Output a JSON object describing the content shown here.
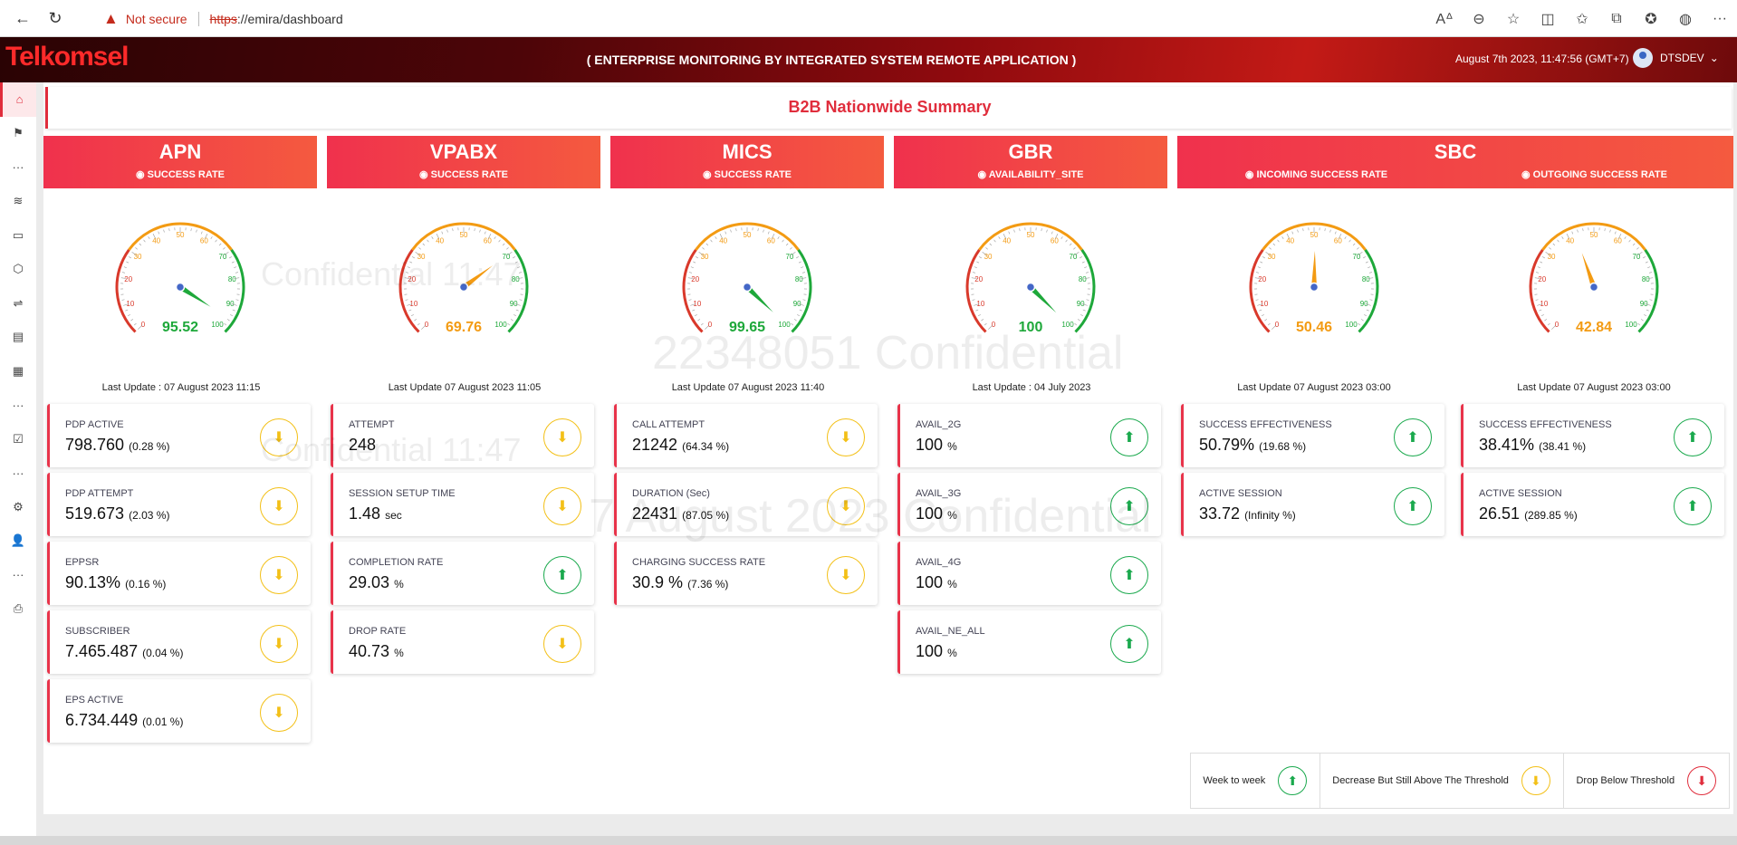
{
  "browser": {
    "not_secure": "Not secure",
    "url_protocol": "https",
    "url_rest": "://emira/dashboard"
  },
  "header": {
    "brand": "Telkomsel",
    "title": "( ENTERPRISE MONITORING BY INTEGRATED SYSTEM REMOTE APPLICATION )",
    "datetime": "August 7th 2023, 11:47:56 (GMT+7)",
    "user": "DTSDEV"
  },
  "page_title": "B2B Nationwide Summary",
  "columns": [
    {
      "name": "APN",
      "subtitle": "SUCCESS RATE",
      "gauge_value": "95.52",
      "gauge_pct": 95.52,
      "gauge_color": "#1ea83a",
      "last_update": "Last Update : 07 August 2023 11:15",
      "cards": [
        {
          "label": "PDP ACTIVE",
          "value": "798.760",
          "pct": "(0.28 %)",
          "trend": "down"
        },
        {
          "label": "PDP ATTEMPT",
          "value": "519.673",
          "pct": "(2.03 %)",
          "trend": "down"
        },
        {
          "label": "EPPSR",
          "value": "90.13%",
          "pct": "(0.16 %)",
          "trend": "down"
        },
        {
          "label": "SUBSCRIBER",
          "value": "7.465.487",
          "pct": "(0.04 %)",
          "trend": "down"
        },
        {
          "label": "EPS ACTIVE",
          "value": "6.734.449",
          "pct": "(0.01 %)",
          "trend": "down"
        }
      ]
    },
    {
      "name": "VPABX",
      "subtitle": "SUCCESS RATE",
      "gauge_value": "69.76",
      "gauge_pct": 69.76,
      "gauge_color": "#f39b13",
      "last_update": "Last Update 07 August 2023 11:05",
      "cards": [
        {
          "label": "ATTEMPT",
          "value": "248",
          "pct": "",
          "trend": "down"
        },
        {
          "label": "SESSION SETUP TIME",
          "value": "1.48",
          "pct": "sec",
          "trend": "down"
        },
        {
          "label": "COMPLETION RATE",
          "value": "29.03",
          "pct": "%",
          "trend": "up"
        },
        {
          "label": "DROP RATE",
          "value": "40.73",
          "pct": "%",
          "trend": "down"
        }
      ]
    },
    {
      "name": "MICS",
      "subtitle": "SUCCESS RATE",
      "gauge_value": "99.65",
      "gauge_pct": 99.65,
      "gauge_color": "#1ea83a",
      "last_update": "Last Update 07 August 2023 11:40",
      "cards": [
        {
          "label": "CALL ATTEMPT",
          "value": "21242",
          "pct": "(64.34 %)",
          "trend": "down"
        },
        {
          "label": "DURATION (Sec)",
          "value": "22431",
          "pct": "(87.05 %)",
          "trend": "down"
        },
        {
          "label": "CHARGING SUCCESS RATE",
          "value": "30.9 %",
          "pct": "(7.36 %)",
          "trend": "down"
        }
      ]
    },
    {
      "name": "GBR",
      "subtitle": "AVAILABILITY_SITE",
      "gauge_value": "100",
      "gauge_pct": 100,
      "gauge_color": "#1ea83a",
      "last_update": "Last Update : 04 July 2023",
      "cards": [
        {
          "label": "AVAIL_2G",
          "value": "100",
          "pct": "%",
          "trend": "up"
        },
        {
          "label": "AVAIL_3G",
          "value": "100",
          "pct": "%",
          "trend": "up"
        },
        {
          "label": "AVAIL_4G",
          "value": "100",
          "pct": "%",
          "trend": "up"
        },
        {
          "label": "AVAIL_NE_ALL",
          "value": "100",
          "pct": "%",
          "trend": "up"
        }
      ]
    }
  ],
  "sbc": {
    "name": "SBC",
    "incoming": {
      "subtitle": "INCOMING SUCCESS RATE",
      "gauge_value": "50.46",
      "gauge_pct": 50.46,
      "gauge_color": "#f39b13",
      "last_update": "Last Update 07 August 2023 03:00",
      "cards": [
        {
          "label": "SUCCESS EFFECTIVENESS",
          "value": "50.79%",
          "pct": "(19.68 %)",
          "trend": "up"
        },
        {
          "label": "ACTIVE SESSION",
          "value": "33.72",
          "pct": "(Infinity %)",
          "trend": "up"
        }
      ]
    },
    "outgoing": {
      "subtitle": "OUTGOING SUCCESS RATE",
      "gauge_value": "42.84",
      "gauge_pct": 42.84,
      "gauge_color": "#f39b13",
      "last_update": "Last Update 07 August 2023 03:00",
      "cards": [
        {
          "label": "SUCCESS EFFECTIVENESS",
          "value": "38.41%",
          "pct": "(38.41 %)",
          "trend": "up"
        },
        {
          "label": "ACTIVE SESSION",
          "value": "26.51",
          "pct": "(289.85 %)",
          "trend": "up"
        }
      ]
    }
  },
  "legend": {
    "week": "Week to week",
    "decrease": "Decrease But Still Above The Threshold",
    "drop": "Drop Below Threshold"
  },
  "watermarks": [
    "Confidential 11:47",
    "22348051 Confidential",
    "Confidential 11:47",
    "7 August 2023 Confidential"
  ],
  "icons": {
    "trend_up": "arrow-up-icon",
    "trend_down": "arrow-down-icon"
  }
}
